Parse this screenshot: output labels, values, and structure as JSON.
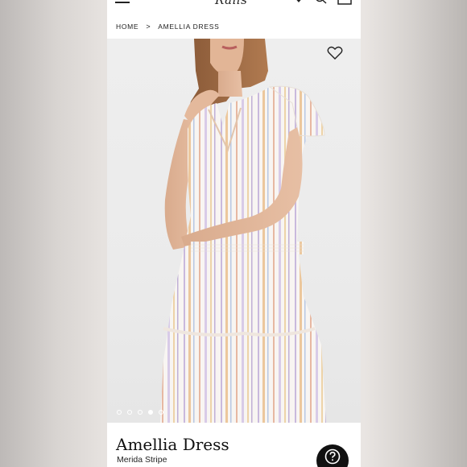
{
  "header": {
    "logo_text": "Rails",
    "icons": [
      "menu-icon",
      "heart-icon",
      "search-icon",
      "bag-icon"
    ]
  },
  "breadcrumb": {
    "home": "HOME",
    "separator": ">",
    "current": "AMELLIA DRESS"
  },
  "gallery": {
    "slide_count": 5,
    "active_index": 3
  },
  "product": {
    "name": "Amellia Dress",
    "variant": "Merida Stripe"
  },
  "colors": {
    "text": "#222222",
    "help_button": "#111111"
  }
}
